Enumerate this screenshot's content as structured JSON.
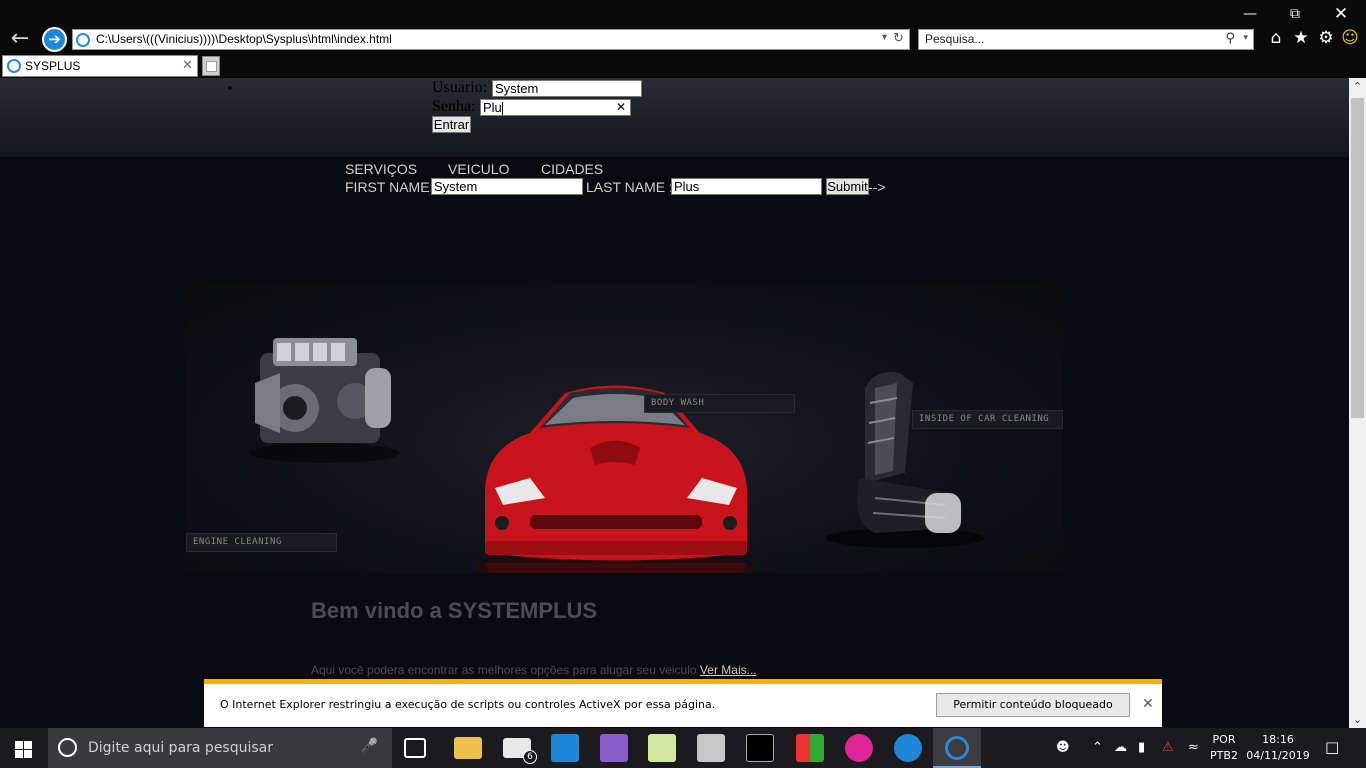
{
  "browser": {
    "address": "C:\\Users\\(((Vinicius))))\\Desktop\\Sysplus\\html\\index.html",
    "search_placeholder": "Pesquisa...",
    "tab_title": "SYSPLUS"
  },
  "login": {
    "user_label": "Usuario:",
    "user_value": "System",
    "pass_label": "Senha:",
    "pass_value": "Plu",
    "enter_label": "Entrar"
  },
  "nav": {
    "items": [
      "SERVIÇOS",
      "VEICULO",
      "CIDADES"
    ]
  },
  "name_form": {
    "first_label": "FIRST NAME:",
    "first_value": "System",
    "last_label": "LAST NAME :",
    "last_value": "Plus",
    "submit_label": "Submit",
    "trailing_text": "-->"
  },
  "banner": {
    "labels": [
      "BODY WASH",
      "INSIDE OF CAR CLEANING",
      "ENGINE CLEANING"
    ]
  },
  "welcome": {
    "title": "Bem vindo a SYSTEMPLUS",
    "text": "Aqui você podera encontrar as melhores opções para alugar seu veiculo",
    "link": "Ver Mais..."
  },
  "notification": {
    "message": "O Internet Explorer restringiu a execução de scripts ou controles ActiveX por essa página.",
    "button": "Permitir conteúdo bloqueado"
  },
  "taskbar": {
    "search_placeholder": "Digite aqui para pesquisar",
    "mail_badge": "6",
    "lang_1": "POR",
    "lang_2": "PTB2",
    "time": "18:16",
    "date": "04/11/2019"
  },
  "colors": {
    "accent": "#1e88d8",
    "notify_border": "#f2b400",
    "car_red": "#c8141a"
  }
}
